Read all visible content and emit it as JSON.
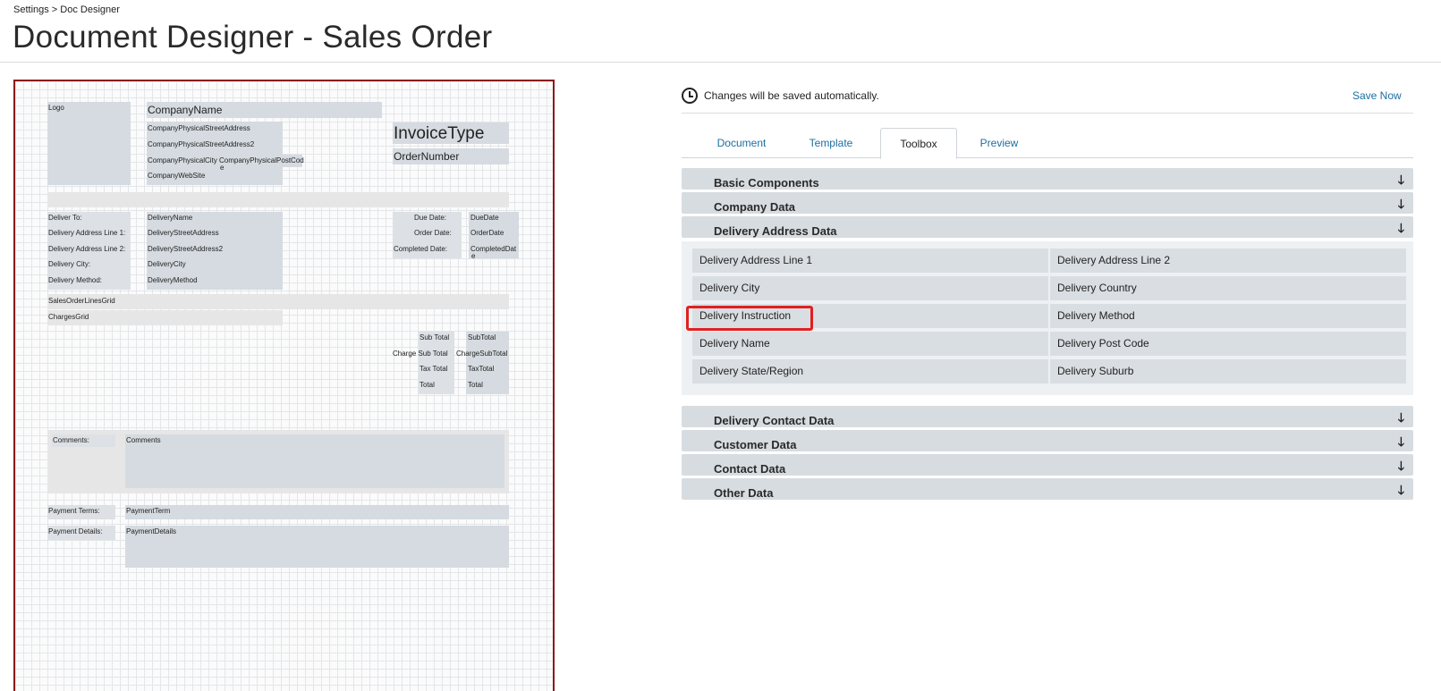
{
  "breadcrumb": "Settings > Doc Designer",
  "page_title": "Document Designer - Sales Order",
  "canvas": {
    "logo": "Logo",
    "company_name": "CompanyName",
    "street1": "CompanyPhysicalStreetAddress",
    "street2": "CompanyPhysicalStreetAddress2",
    "city": "CompanyPhysicalCity",
    "postcode": "CompanyPhysicalPostCod",
    "postcode_wrap": "e",
    "website": "CompanyWebSite",
    "invoice_type": "InvoiceType",
    "order_number": "OrderNumber",
    "deliver_to_lbl": "Deliver To:",
    "addr1_lbl": "Delivery Address Line 1:",
    "addr2_lbl": "Delivery Address Line 2:",
    "city_lbl": "Delivery City:",
    "method_lbl": "Delivery Method:",
    "delivery_name": "DeliveryName",
    "delivery_street": "DeliveryStreetAddress",
    "delivery_street2": "DeliveryStreetAddress2",
    "delivery_city": "DeliveryCity",
    "delivery_method": "DeliveryMethod",
    "due_date_lbl": "Due Date:",
    "order_date_lbl": "Order Date:",
    "completed_date_lbl": "Completed Date:",
    "due_date": "DueDate",
    "order_date": "OrderDate",
    "completed_date": "CompletedDat",
    "completed_date_wrap": "e",
    "lines_grid": "SalesOrderLinesGrid",
    "charges_grid": "ChargesGrid",
    "subtotal_lbl": "Sub Total",
    "subtotal": "SubTotal",
    "charge_subtotal_lbl": "Charge Sub Total",
    "charge_subtotal": "ChargeSubTotal",
    "tax_total_lbl": "Tax Total",
    "tax_total": "TaxTotal",
    "total_lbl": "Total",
    "total": "Total",
    "comments_lbl": "Comments:",
    "comments": "Comments",
    "payment_terms_lbl": "Payment Terms:",
    "payment_term": "PaymentTerm",
    "payment_details_lbl": "Payment Details:",
    "payment_details": "PaymentDetails"
  },
  "autosave_text": "Changes will be saved automatically.",
  "save_now": "Save Now",
  "tabs": [
    "Document",
    "Template",
    "Toolbox",
    "Preview"
  ],
  "active_tab": "Toolbox",
  "sections": {
    "basic": "Basic Components",
    "company": "Company Data",
    "delivery_address": "Delivery Address Data",
    "delivery_contact": "Delivery Contact Data",
    "customer": "Customer Data",
    "contact": "Contact Data",
    "other": "Other Data"
  },
  "delivery_items": [
    "Delivery Address Line 1",
    "Delivery Address Line 2",
    "Delivery City",
    "Delivery Country",
    "Delivery Instruction",
    "Delivery Method",
    "Delivery Name",
    "Delivery Post Code",
    "Delivery State/Region",
    "Delivery Suburb"
  ],
  "highlighted_item": "Delivery Instruction",
  "colors": {
    "link": "#1c6fa0",
    "highlight": "#e02020",
    "canvas_border": "#8b1a1a"
  }
}
